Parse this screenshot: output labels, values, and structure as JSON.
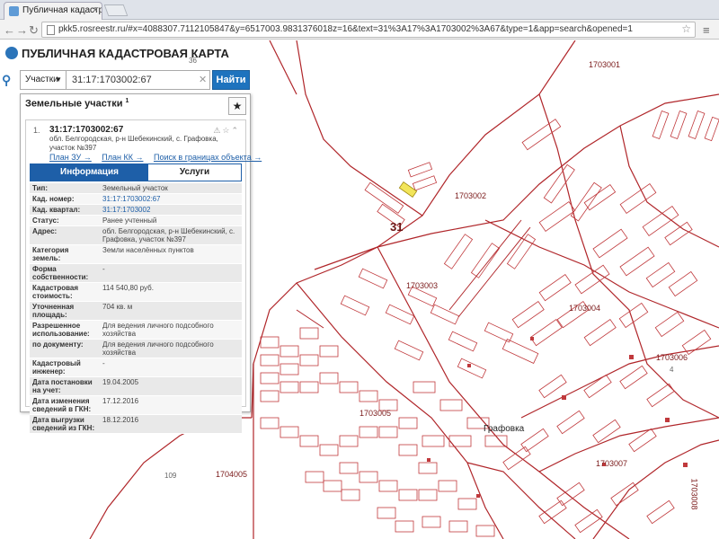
{
  "browser": {
    "tab_title": "Публичная кадастрова",
    "url": "pkk5.rosreestr.ru/#x=4088307.7112105847&y=6517003.9831376018z=16&text=31%3A17%3A1703002%3A67&type=1&app=search&opened=1"
  },
  "app": {
    "title": "ПУБЛИЧНАЯ КАДАСТРОВАЯ КАРТА"
  },
  "search": {
    "type_label": "Участки",
    "query": "31:17:1703002:67",
    "button_label": "Найти"
  },
  "panel": {
    "header": "Земельные участки",
    "count": "1",
    "item": {
      "index": "1.",
      "cad_number": "31:17:1703002:67",
      "address": "обл. Белгородская, р-н Шебекинский, с. Графовка, участок №397",
      "links": [
        "План ЗУ →",
        "План КК →",
        "Поиск в границах объекта →"
      ],
      "tabs": [
        "Информация",
        "Услуги"
      ],
      "attributes": [
        {
          "k": "Тип:",
          "v": "Земельный участок"
        },
        {
          "k": "Кад. номер:",
          "v": "31:17:1703002:67",
          "link": true
        },
        {
          "k": "Кад. квартал:",
          "v": "31:17:1703002",
          "link": true
        },
        {
          "k": "Статус:",
          "v": "Ранее учтенный"
        },
        {
          "k": "Адрес:",
          "v": "обл. Белгородская, р-н Шебекинский, с. Графовка, участок №397"
        },
        {
          "k": "Категория земель:",
          "v": "Земли населённых пунктов"
        },
        {
          "k": "Форма собственности:",
          "v": "-"
        },
        {
          "k": "Кадастровая стоимость:",
          "v": "114 540,80 руб."
        },
        {
          "k": "Уточненная площадь:",
          "v": "704 кв. м"
        },
        {
          "k": "Разрешенное использование:",
          "v": "Для ведения личного подсобного хозяйства"
        },
        {
          "k": "по документу:",
          "v": "Для ведения личного подсобного хозяйства"
        },
        {
          "k": "Кадастровый инженер:",
          "v": "-"
        },
        {
          "k": "Дата постановки на учет:",
          "v": "19.04.2005"
        },
        {
          "k": "Дата изменения сведений в ГКН:",
          "v": "17.12.2016"
        },
        {
          "k": "Дата выгрузки сведений из ГКН:",
          "v": "18.12.2016"
        }
      ]
    }
  },
  "map": {
    "labels": [
      {
        "id": "q1703001",
        "text": "1703001"
      },
      {
        "id": "q1703002",
        "text": "1703002"
      },
      {
        "id": "q1703003",
        "text": "1703003"
      },
      {
        "id": "q1703004",
        "text": "1703004"
      },
      {
        "id": "q1703005",
        "text": "1703005"
      },
      {
        "id": "q1703006",
        "text": "1703006"
      },
      {
        "id": "q1703007",
        "text": "1703007"
      },
      {
        "id": "q1703008",
        "text": "1703008"
      },
      {
        "id": "q1704005",
        "text": "1704005"
      },
      {
        "id": "q31",
        "text": "31"
      },
      {
        "id": "town",
        "text": "Графовка"
      },
      {
        "id": "n36",
        "text": "36"
      },
      {
        "id": "n109",
        "text": "109"
      },
      {
        "id": "n4",
        "text": "4"
      }
    ],
    "colors": {
      "boundary": "#b0262a",
      "highlight": "#f2e55a"
    }
  },
  "icons": [
    "search-icon",
    "star-icon",
    "clear-icon",
    "menu-icon",
    "back-icon",
    "forward-icon",
    "reload-icon"
  ]
}
